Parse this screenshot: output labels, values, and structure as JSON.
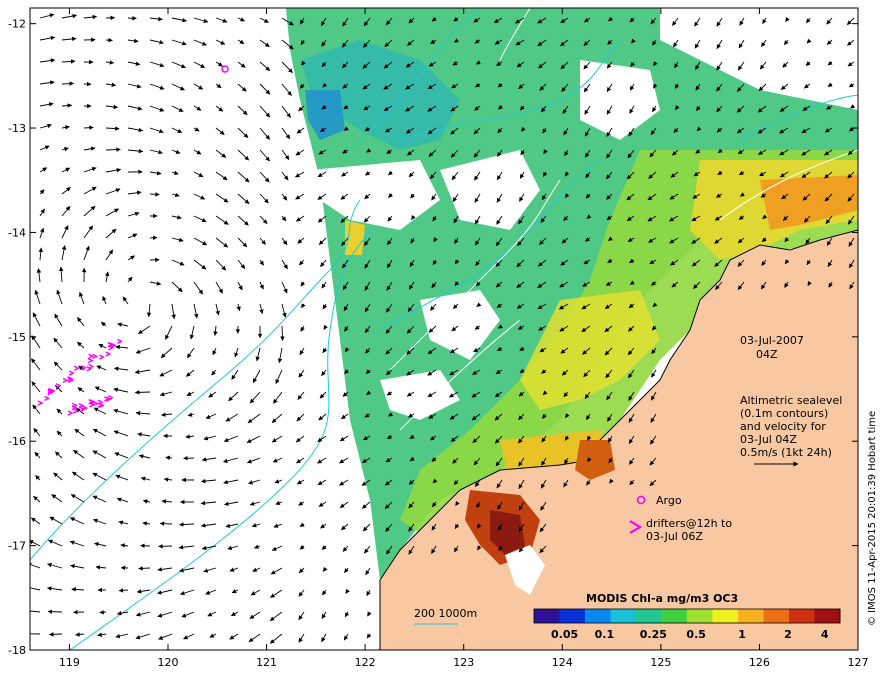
{
  "map": {
    "lon_range": [
      118.6,
      127
    ],
    "lat_range": [
      -18,
      -11.85
    ],
    "lon_ticks": [
      "119",
      "120",
      "121",
      "122",
      "123",
      "124",
      "125",
      "126",
      "127"
    ],
    "lat_ticks": [
      "-12",
      "-13",
      "-14",
      "-15",
      "-16",
      "-17",
      "-18"
    ],
    "colors": {
      "land": "#f8c8a2",
      "coastline": "#000000",
      "isobath": "#22c8e0",
      "sealevel_contour": "#ffffff",
      "arrow": "#000000",
      "drifter": "#ff00ff",
      "argo": "#ff00ff"
    }
  },
  "annotations": {
    "date": "03-Jul-2007",
    "time": "04Z",
    "legend_lines": [
      "Altimetric sealevel",
      "(0.1m contours)",
      "and velocity for",
      "03-Jul 04Z",
      "0.5m/s (1kt 24h)"
    ],
    "argo_label": "Argo",
    "drifter_label_1": "drifters@12h to",
    "drifter_label_2": "03-Jul 06Z",
    "isobath_label": "200  1000m",
    "credit": "© IMOS 11-Apr-2015 20:01:39 Hobart time"
  },
  "colorbar": {
    "title": "MODIS Chl-a mg/m3 OC3",
    "tick_labels": [
      "0.05",
      "0.1",
      "0.25",
      "0.5",
      "1",
      "2",
      "4"
    ],
    "colors": [
      "#2b1296",
      "#0a32d8",
      "#0888f0",
      "#18c0d8",
      "#20c890",
      "#40d040",
      "#a0e030",
      "#f0f020",
      "#f8b020",
      "#f07018",
      "#d03010",
      "#a01010"
    ]
  }
}
